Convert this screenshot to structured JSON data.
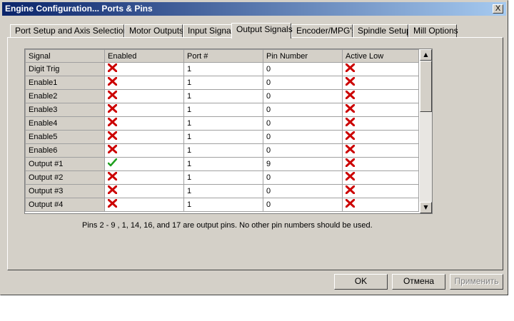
{
  "window": {
    "title": "Engine Configuration... Ports & Pins",
    "close_label": "X"
  },
  "tabs": [
    {
      "label": "Port Setup and Axis Selection"
    },
    {
      "label": "Motor Outputs"
    },
    {
      "label": "Input Signals"
    },
    {
      "label": "Output Signals",
      "active": true
    },
    {
      "label": "Encoder/MPG's"
    },
    {
      "label": "Spindle Setup"
    },
    {
      "label": "Mill Options"
    }
  ],
  "table": {
    "headers": [
      "Signal",
      "Enabled",
      "Port #",
      "Pin Number",
      "Active Low"
    ],
    "rows": [
      {
        "signal": "Digit  Trig",
        "enabled": false,
        "port": "1",
        "pin": "0",
        "active_low": false
      },
      {
        "signal": "Enable1",
        "enabled": false,
        "port": "1",
        "pin": "0",
        "active_low": false
      },
      {
        "signal": "Enable2",
        "enabled": false,
        "port": "1",
        "pin": "0",
        "active_low": false
      },
      {
        "signal": "Enable3",
        "enabled": false,
        "port": "1",
        "pin": "0",
        "active_low": false
      },
      {
        "signal": "Enable4",
        "enabled": false,
        "port": "1",
        "pin": "0",
        "active_low": false
      },
      {
        "signal": "Enable5",
        "enabled": false,
        "port": "1",
        "pin": "0",
        "active_low": false
      },
      {
        "signal": "Enable6",
        "enabled": false,
        "port": "1",
        "pin": "0",
        "active_low": false
      },
      {
        "signal": "Output #1",
        "enabled": true,
        "port": "1",
        "pin": "9",
        "active_low": false
      },
      {
        "signal": "Output #2",
        "enabled": false,
        "port": "1",
        "pin": "0",
        "active_low": false
      },
      {
        "signal": "Output #3",
        "enabled": false,
        "port": "1",
        "pin": "0",
        "active_low": false
      },
      {
        "signal": "Output #4",
        "enabled": false,
        "port": "1",
        "pin": "0",
        "active_low": false
      }
    ]
  },
  "icons": {
    "enabled_true": "green-check-icon",
    "enabled_false": "red-x-icon"
  },
  "colors": {
    "check": "#1fa01f",
    "cross": "#cc0000",
    "title_start": "#0a246a",
    "title_end": "#a6caf0"
  },
  "note": "Pins 2 - 9 , 1, 14, 16, and 17 are output pins. No  other pin numbers should be used.",
  "buttons": {
    "ok": "OK",
    "cancel": "Отмена",
    "apply": "Применить"
  }
}
